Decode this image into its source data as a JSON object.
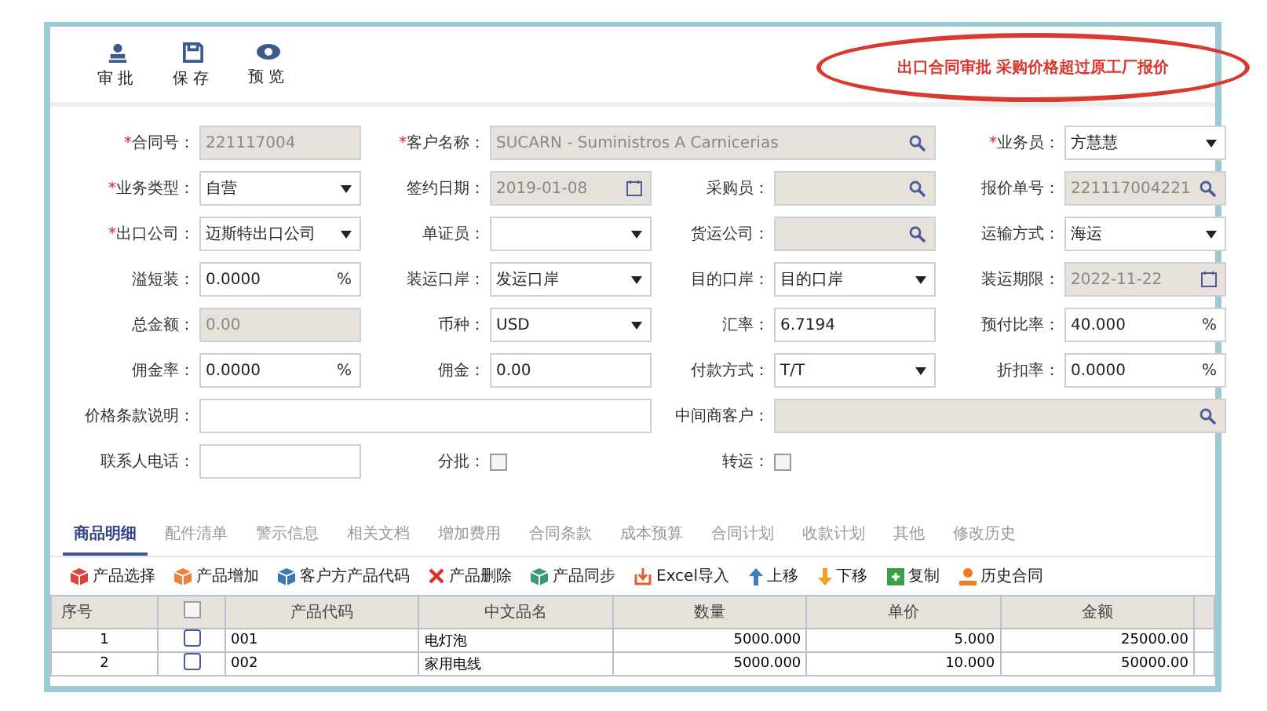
{
  "toolbar": [
    {
      "kind": "approve",
      "label": "审批"
    },
    {
      "kind": "save",
      "label": "保存"
    },
    {
      "kind": "preview",
      "label": "预览"
    }
  ],
  "annotation": "出口合同审批 采购价格超过原工厂报价",
  "form_rows": [
    [
      {
        "marker": "*",
        "label": "合同号：",
        "kind": "text",
        "value": "221117004",
        "readonly": true
      },
      {
        "marker": "*",
        "label": "客户名称：",
        "kind": "search",
        "value": "SUCARN - Suministros A Carnicerias",
        "readonly": true
      },
      {
        "marker": "*",
        "label": "业务员：",
        "kind": "select",
        "value": "方慧慧",
        "readonly": false
      }
    ],
    [
      {
        "marker": "*",
        "label": "业务类型：",
        "kind": "select",
        "value": "自营",
        "readonly": false
      },
      {
        "label": "签约日期：",
        "kind": "date",
        "value": "2019-01-08",
        "readonly": true
      },
      {
        "label": "采购员：",
        "kind": "search",
        "readonly": true
      },
      {
        "label": "报价单号：",
        "kind": "search",
        "value": "221117004221",
        "readonly": true
      }
    ],
    [
      {
        "marker": "*",
        "label": "出口公司：",
        "kind": "select",
        "value": "迈斯特出口公司",
        "readonly": false
      },
      {
        "label": "单证员：",
        "kind": "select",
        "readonly": false
      },
      {
        "label": "货运公司：",
        "kind": "search",
        "readonly": true
      },
      {
        "label": "运输方式：",
        "kind": "select",
        "value": "海运",
        "readonly": false
      }
    ],
    [
      {
        "label": "溢短装：",
        "kind": "percent",
        "value": "0.0000",
        "unit": "%",
        "readonly": false
      },
      {
        "label": "装运口岸：",
        "kind": "select",
        "value": "发运口岸",
        "readonly": false
      },
      {
        "label": "目的口岸：",
        "kind": "select",
        "value": "目的口岸",
        "readonly": false
      },
      {
        "label": "装运期限：",
        "kind": "date",
        "value": "2022-11-22",
        "readonly": true
      }
    ],
    [
      {
        "label": "总金额：",
        "kind": "text",
        "value": "0.00",
        "readonly": true
      },
      {
        "label": "币种：",
        "kind": "select",
        "value": "USD",
        "readonly": false
      },
      {
        "label": "汇率：",
        "kind": "text",
        "value": "6.7194",
        "readonly": false
      },
      {
        "label": "预付比率：",
        "kind": "percent",
        "value": "40.000",
        "unit": "%",
        "readonly": false
      }
    ],
    [
      {
        "label": "佣金率：",
        "kind": "percent",
        "value": "0.0000",
        "unit": "%",
        "readonly": false
      },
      {
        "label": "佣金：",
        "kind": "text",
        "value": "0.00",
        "readonly": false
      },
      {
        "label": "付款方式：",
        "kind": "select",
        "value": "T/T",
        "readonly": false
      },
      {
        "label": "折扣率：",
        "kind": "percent",
        "value": "0.0000",
        "unit": "%",
        "readonly": false
      }
    ],
    [
      {
        "label": "价格条款说明：",
        "kind": "textarea",
        "readonly": false
      },
      {
        "label": "中间商客户：",
        "kind": "search",
        "readonly": true
      }
    ],
    [
      {
        "label": "联系人电话：",
        "kind": "text",
        "readonly": false
      },
      {
        "label": "分批：",
        "kind": "checkbox",
        "checked": false
      },
      {
        "label": "转运：",
        "kind": "checkbox",
        "checked": false
      }
    ]
  ],
  "tabs": [
    {
      "label": "商品明细",
      "selected": true
    },
    {
      "label": "配件清单",
      "selected": false
    },
    {
      "label": "警示信息",
      "selected": false
    },
    {
      "label": "相关文档",
      "selected": false
    },
    {
      "label": "增加费用",
      "selected": false
    },
    {
      "label": "合同条款",
      "selected": false
    },
    {
      "label": "成本预算",
      "selected": false
    },
    {
      "label": "合同计划",
      "selected": false
    },
    {
      "label": "收款计划",
      "selected": false
    },
    {
      "label": "其他",
      "selected": false
    },
    {
      "label": "修改历史",
      "selected": false
    }
  ],
  "actions": [
    {
      "kind": "box",
      "color": "#d9453a",
      "label": "产品选择"
    },
    {
      "kind": "box",
      "color": "#e8833a",
      "label": "产品增加"
    },
    {
      "kind": "box",
      "color": "#3a78b8",
      "label": "客户方产品代码"
    },
    {
      "kind": "delete",
      "color": "#d9302a",
      "label": "产品删除"
    },
    {
      "kind": "box",
      "color": "#3a9a78",
      "label": "产品同步"
    },
    {
      "kind": "import",
      "color": "#e0602a",
      "label": "Excel导入"
    },
    {
      "kind": "up",
      "color": "#3a7fc8",
      "label": "上移"
    },
    {
      "kind": "down",
      "color": "#f0a020",
      "label": "下移"
    },
    {
      "kind": "copy",
      "color": "#3aa04a",
      "label": "复制"
    },
    {
      "kind": "history",
      "color": "#f07a20",
      "label": "历史合同"
    }
  ],
  "table": {
    "columns": [
      "序号",
      "产品代码",
      "中文品名",
      "数量",
      "单价",
      "金额"
    ],
    "all_checked": false,
    "rows": [
      {
        "index": "1",
        "checked": false,
        "code": "001",
        "name": "电灯泡",
        "qty": "5000.000",
        "price": "5.000",
        "amount": "25000.00"
      },
      {
        "index": "2",
        "checked": false,
        "code": "002",
        "name": "家用电线",
        "qty": "5000.000",
        "price": "10.000",
        "amount": "50000.00"
      }
    ]
  }
}
